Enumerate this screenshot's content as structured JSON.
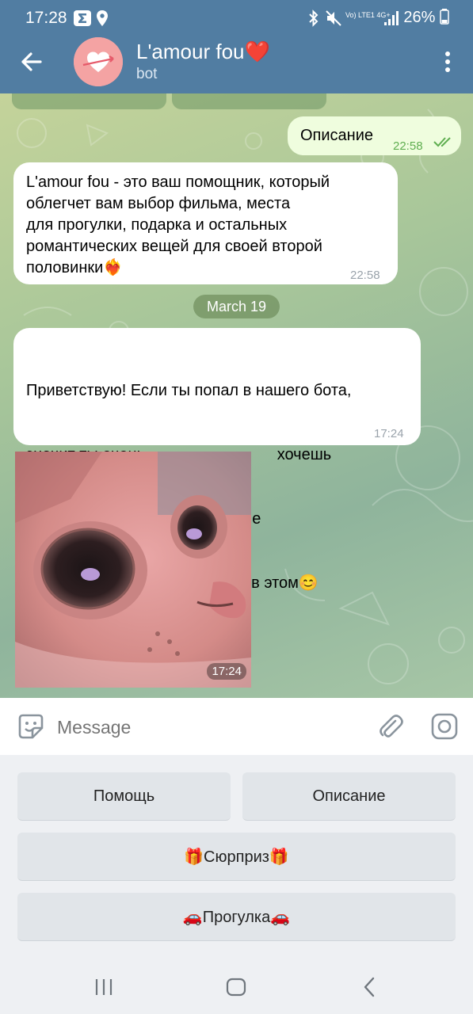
{
  "status_bar": {
    "time": "17:28",
    "battery": "26%",
    "network": "Vo) LTE1 4G+"
  },
  "header": {
    "title": "L'amour fou❤️",
    "subtitle": "bot"
  },
  "messages": [
    {
      "direction": "out",
      "text": "Описание",
      "time": "22:58",
      "status": "read"
    },
    {
      "direction": "in",
      "lines": [
        "L'amour fou - это ваш помощник, который",
        "облегчет вам выбор фильма, места",
        "для прогулки, подарка и остальных",
        "романтических вещей для своей второй",
        "половинки❤️‍🔥"
      ],
      "time": "22:58"
    },
    {
      "direction": "in",
      "lines": [
        "Приветствую! Если ты попал в нашего бота,",
        "значит ты очень                              хочешь",
        "порадовать свою половинку. Не",
        "переживай, мы поможем тебе в этом😊"
      ],
      "time": "17:24"
    },
    {
      "direction": "in",
      "type": "photo",
      "time": "17:24"
    }
  ],
  "date_separator": "March 19",
  "input": {
    "placeholder": "Message"
  },
  "keyboard": {
    "buttons": [
      "Помощь",
      "Описание",
      "🎁Сюрприз🎁",
      "🚗Прогулка🚗"
    ]
  },
  "icons": [
    "back-arrow-icon",
    "more-vert-icon",
    "sticker-icon",
    "attach-icon",
    "camera-icon",
    "recent-apps-icon",
    "home-icon",
    "back-icon"
  ],
  "colors": {
    "header": "#517da2",
    "outgoing_bubble": "#effdde",
    "incoming_bubble": "#ffffff"
  }
}
